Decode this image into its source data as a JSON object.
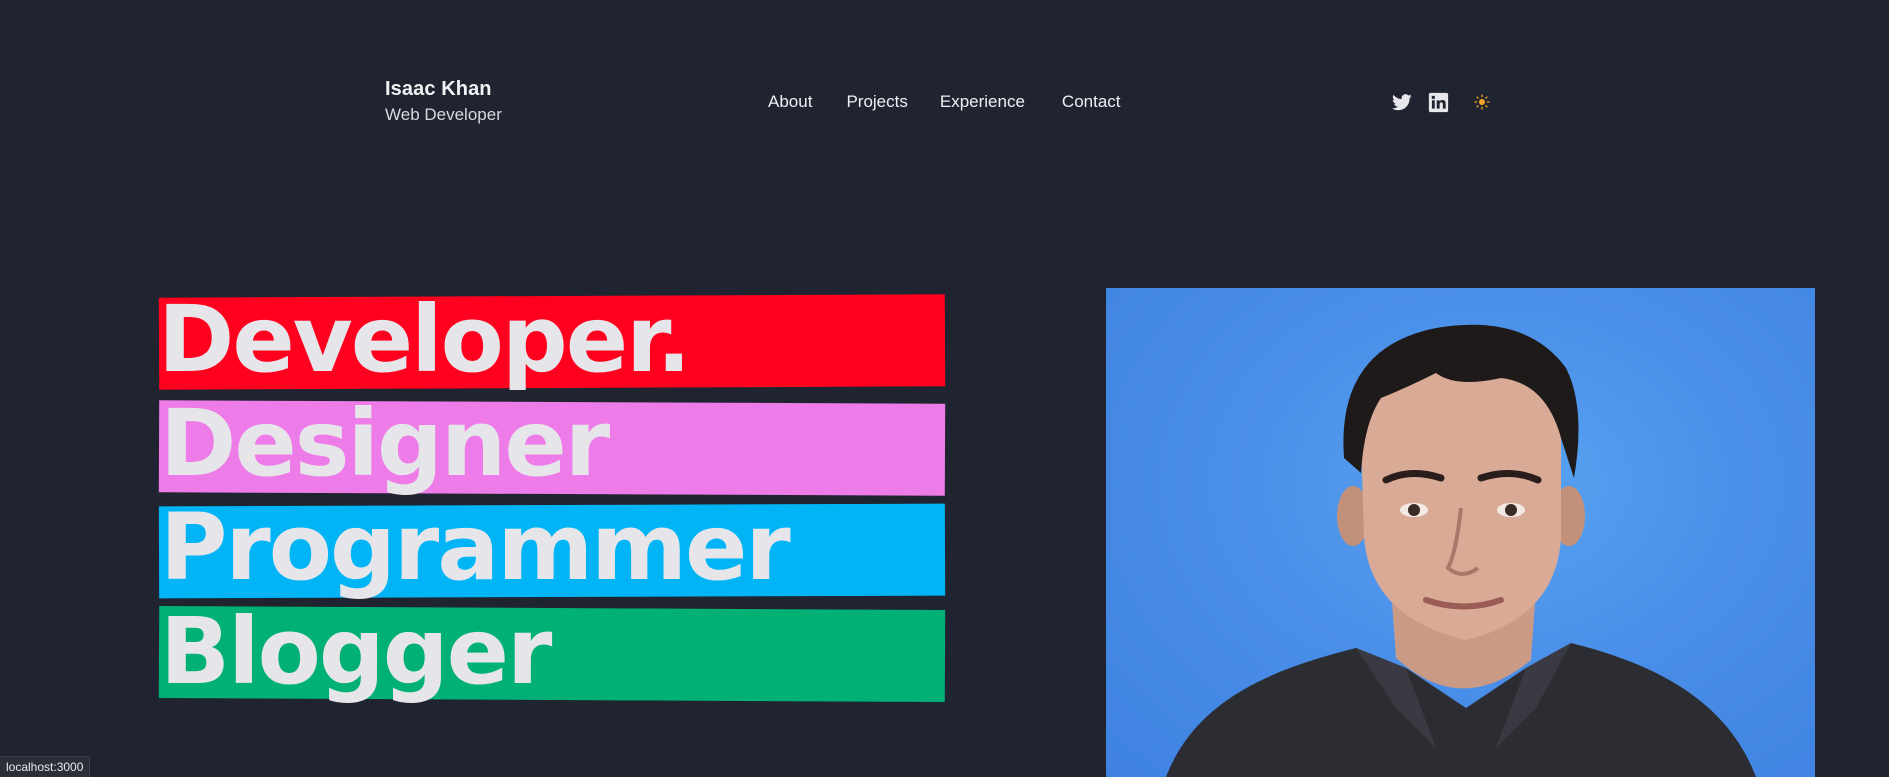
{
  "header": {
    "name": "Isaac Khan",
    "role": "Web Developer"
  },
  "nav": {
    "items": [
      "About",
      "Projects",
      "Experience",
      "Contact"
    ]
  },
  "social": {
    "icons": [
      "twitter-icon",
      "linkedin-icon",
      "sun-icon"
    ]
  },
  "hero": {
    "words": [
      {
        "text": "Developer.",
        "color": "#ff001e"
      },
      {
        "text": "Designer",
        "color": "#ee7ce8"
      },
      {
        "text": "Programmer",
        "color": "#00b4f5"
      },
      {
        "text": "Blogger",
        "color": "#00b075"
      }
    ]
  },
  "status_bar": {
    "url": "localhost:3000"
  },
  "colors": {
    "background": "#1f2430",
    "text": "#e6e6ea",
    "sun_accent": "#f5a623",
    "portrait_bg": "#4a8fe8"
  }
}
